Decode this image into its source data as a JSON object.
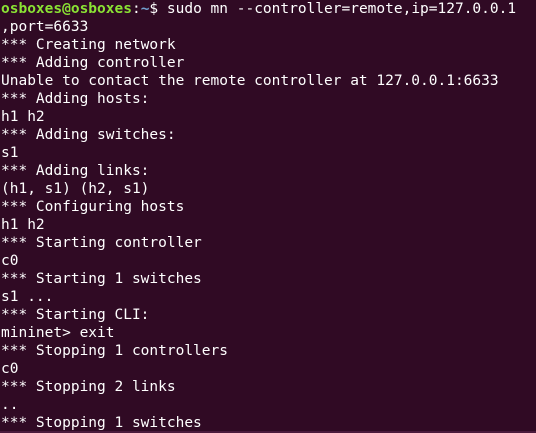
{
  "prompt": {
    "user_host": "osboxes@osboxes",
    "separator": ":",
    "path": "~",
    "symbol": "$ ",
    "command": "sudo mn --controller=remote,ip=127.0.0.1"
  },
  "colors": {
    "background": "#300a24",
    "text": "#ffffff",
    "prompt_user": "#8ae234",
    "prompt_path": "#729fcf"
  },
  "output_lines": [
    ",port=6633",
    "*** Creating network",
    "*** Adding controller",
    "Unable to contact the remote controller at 127.0.0.1:6633",
    "*** Adding hosts:",
    "h1 h2",
    "*** Adding switches:",
    "s1",
    "*** Adding links:",
    "(h1, s1) (h2, s1)",
    "*** Configuring hosts",
    "h1 h2",
    "*** Starting controller",
    "c0",
    "*** Starting 1 switches",
    "s1 ...",
    "*** Starting CLI:",
    "mininet> exit",
    "*** Stopping 1 controllers",
    "c0",
    "*** Stopping 2 links",
    "..",
    "*** Stopping 1 switches"
  ]
}
